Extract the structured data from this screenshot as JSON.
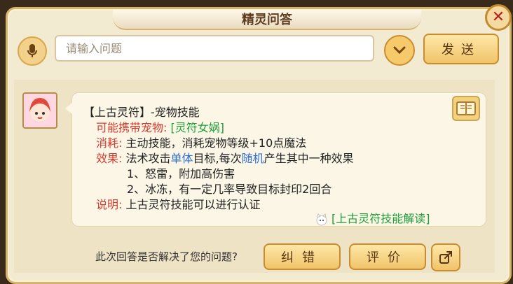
{
  "window": {
    "title": "精灵问答"
  },
  "search": {
    "placeholder": "请输入问题",
    "send_label": "发送"
  },
  "answer": {
    "header_line": "【上古灵符】-宠物技能",
    "pet_label": "可能携带宠物:",
    "pet_value": "[灵符女娲]",
    "cost_label": "消耗:",
    "cost_value": "主动技能，消耗宠物等级+10点魔法",
    "effect_label": "效果:",
    "effect_prefix": "法术攻击",
    "effect_highlight1": "单体",
    "effect_mid": "目标,每次",
    "effect_highlight2": "随机",
    "effect_suffix": "产生其中一种效果",
    "effect_1": "1、怒雷，附加高伤害",
    "effect_2": "2、冰冻，有一定几率导致目标封印2回合",
    "note_label": "说明:",
    "note_value": "上古灵符技能可以进行认证",
    "link_text": "[上古灵符技能解读]"
  },
  "footer": {
    "question": "此次回答是否解决了您的问题?",
    "correct_label": "纠错",
    "rate_label": "评价"
  },
  "icons": [
    "close-icon",
    "microphone-icon",
    "chevron-down-icon",
    "book-icon",
    "share-icon",
    "cat-icon"
  ],
  "colors": {
    "red": "#d43b2e",
    "green": "#1f9e3a",
    "blue": "#2e6dd8",
    "frame": "#d9b36a"
  }
}
